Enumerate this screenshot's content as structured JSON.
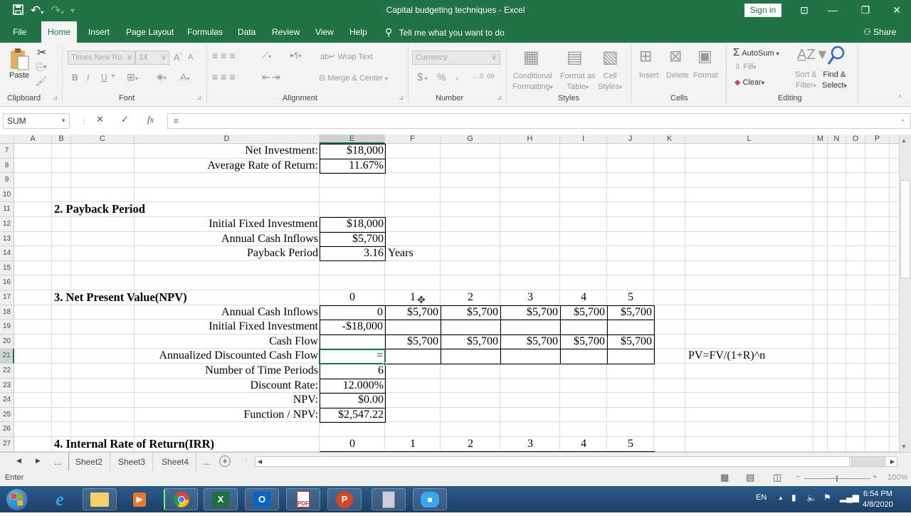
{
  "window": {
    "title": "Capital budgeting techniques  -  Excel",
    "sign_in": "Sign in",
    "qat": {
      "save_icon": "save-icon",
      "undo_icon": "undo-icon",
      "redo_icon": "redo-icon",
      "customize_icon": "customize-qat-icon"
    },
    "controls": {
      "ribbon_display": "⊡",
      "minimize": "—",
      "restore": "❐",
      "close": "✕"
    }
  },
  "menu": {
    "tabs": [
      "File",
      "Home",
      "Insert",
      "Page Layout",
      "Formulas",
      "Data",
      "Review",
      "View",
      "Help"
    ],
    "active": "Home",
    "tell_me": "Tell me what you want to do",
    "share": "Share"
  },
  "ribbon": {
    "clipboard": {
      "label": "Clipboard",
      "paste": "Paste"
    },
    "font": {
      "label": "Font",
      "font_name": "Times New Ro",
      "font_size": "14",
      "bold": "B",
      "italic": "I",
      "underline": "U"
    },
    "alignment": {
      "label": "Alignment",
      "wrap_text": "Wrap Text",
      "merge_center": "Merge & Center"
    },
    "number": {
      "label": "Number",
      "format": "Currency",
      "dollar": "$",
      "percent": "%",
      "comma": ","
    },
    "styles": {
      "label": "Styles",
      "conditional_formatting": "Conditional",
      "conditional_formatting2": "Formatting",
      "format_as_table": "Format as",
      "format_as_table2": "Table",
      "cell_styles": "Cell",
      "cell_styles2": "Styles"
    },
    "cells": {
      "label": "Cells",
      "insert": "Insert",
      "delete": "Delete",
      "format": "Format"
    },
    "editing": {
      "label": "Editing",
      "autosum": "AutoSum",
      "fill": "Fill",
      "clear": "Clear",
      "sort_filter": "Sort &",
      "sort_filter2": "Filter",
      "find_select": "Find &",
      "find_select2": "Select"
    }
  },
  "formula_bar": {
    "name_box": "SUM",
    "cancel": "✕",
    "enter": "✓",
    "fx": "fx",
    "content": "="
  },
  "columns": [
    "A",
    "B",
    "C",
    "D",
    "E",
    "F",
    "G",
    "H",
    "I",
    "J",
    "K",
    "L",
    "M",
    "N",
    "O",
    "P"
  ],
  "selected_column": "E",
  "rows": [
    "7",
    "8",
    "9",
    "10",
    "11",
    "12",
    "13",
    "14",
    "15",
    "16",
    "17",
    "18",
    "19",
    "20",
    "21",
    "22",
    "23",
    "24",
    "25",
    "26",
    "27"
  ],
  "selected_row": "21",
  "sheet": {
    "r7": {
      "label": "Net Investment:",
      "E": "$18,000"
    },
    "r8": {
      "label": "Average Rate of Return:",
      "E": "11.67%"
    },
    "r11": {
      "heading": "2. Payback Period"
    },
    "r12": {
      "label": "Initial Fixed Investment",
      "E": "$18,000"
    },
    "r13": {
      "label": "Annual Cash Inflows",
      "E": "$5,700"
    },
    "r14": {
      "label": "Payback Period",
      "E": "3.16",
      "F": "Years"
    },
    "r17": {
      "heading": "3. Net Present Value(NPV)",
      "periods": [
        "0",
        "1",
        "2",
        "3",
        "4",
        "5"
      ]
    },
    "r18": {
      "label": "Annual Cash Inflows",
      "values": [
        "0",
        "$5,700",
        "$5,700",
        "$5,700",
        "$5,700",
        "$5,700"
      ]
    },
    "r19": {
      "label": "Initial Fixed Investment",
      "values": [
        "-$18,000",
        "",
        "",
        "",
        "",
        ""
      ]
    },
    "r20": {
      "label": "Cash Flow",
      "values": [
        "",
        "$5,700",
        "$5,700",
        "$5,700",
        "$5,700",
        "$5,700"
      ]
    },
    "r21": {
      "label": "Annualized Discounted Cash Flow",
      "values": [
        "=",
        "",
        "",
        "",
        "",
        ""
      ],
      "L": "PV=FV/(1+R)^n"
    },
    "r22": {
      "label": "Number of Time Periods",
      "E": "6"
    },
    "r23": {
      "label": "Discount Rate:",
      "E": "12.000%"
    },
    "r24": {
      "label": "NPV:",
      "E": "$0.00"
    },
    "r25": {
      "label": "Function / NPV:",
      "E": "$2,547.22"
    },
    "r27": {
      "heading": "4. Internal Rate of Return(IRR)",
      "periods": [
        "0",
        "1",
        "2",
        "3",
        "4",
        "5"
      ]
    }
  },
  "sheet_tabs": {
    "items": [
      "Sheet2",
      "Sheet3",
      "Sheet4"
    ],
    "more": "...",
    "add": "+"
  },
  "status": {
    "mode": "Enter",
    "zoom": "100%"
  },
  "taskbar": {
    "apps": [
      "start",
      "internet-explorer",
      "file-explorer",
      "media-player",
      "chrome",
      "excel",
      "outlook",
      "pdf-reader",
      "powerpoint",
      "calculator",
      "video-call"
    ],
    "language": "EN",
    "time": "6:54 PM",
    "date": "4/8/2020"
  }
}
